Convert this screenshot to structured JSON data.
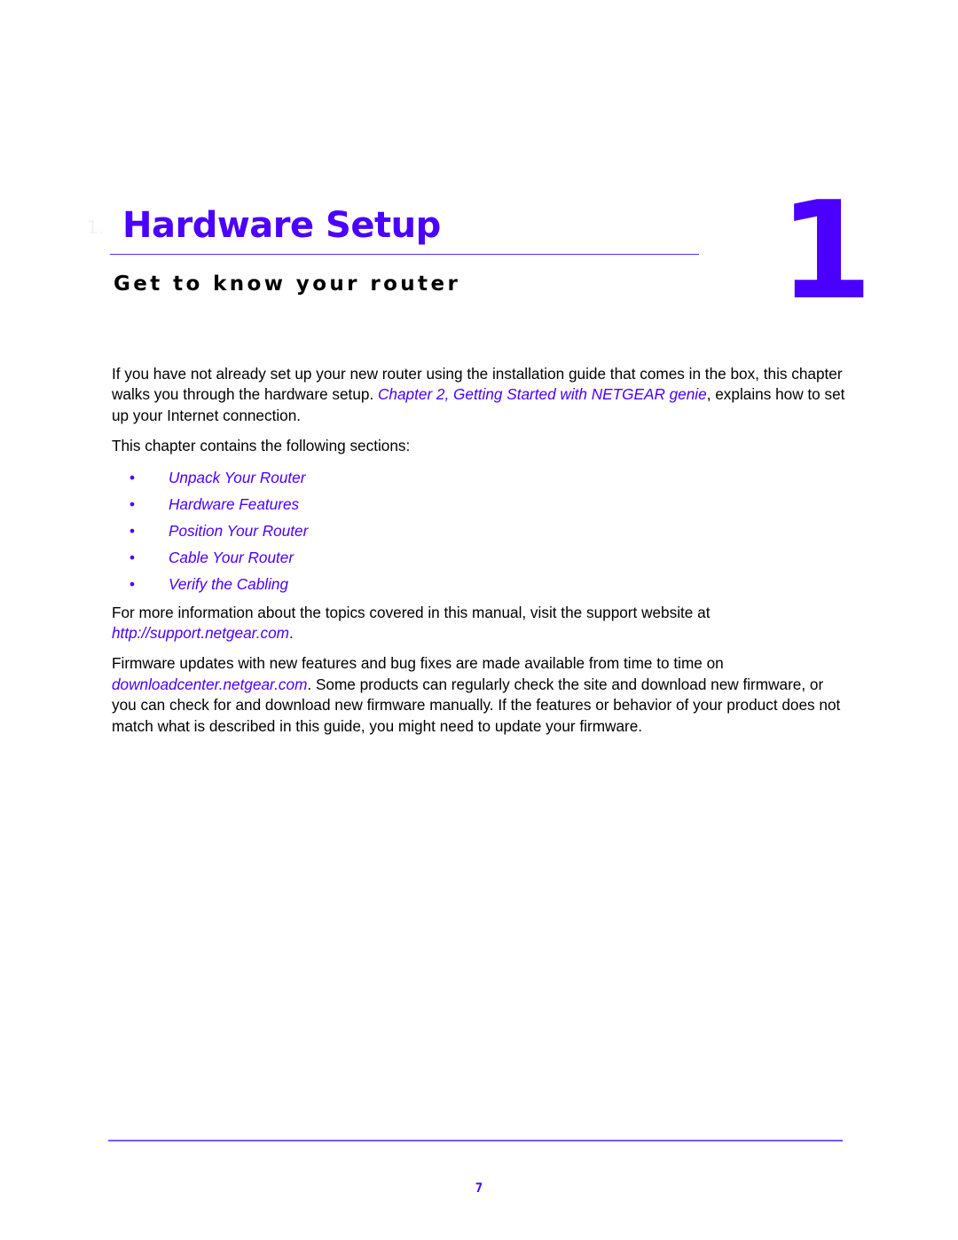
{
  "chapter": {
    "prefix": "1.",
    "title": "Hardware Setup",
    "number": "1",
    "subtitle": "Get to know your router"
  },
  "intro": {
    "text_before": "If you have not already set up your new router using the installation guide that comes in the box, this chapter walks you through the hardware setup. ",
    "link": "Chapter 2, Getting Started with NETGEAR genie",
    "text_after": ", explains how to set up your Internet connection."
  },
  "sections_intro": "This chapter contains the following sections:",
  "sections": [
    {
      "bullet": "•",
      "label": "Unpack Your Router"
    },
    {
      "bullet": "•",
      "label": "Hardware Features"
    },
    {
      "bullet": "•",
      "label": "Position Your Router"
    },
    {
      "bullet": "•",
      "label": "Cable Your Router"
    },
    {
      "bullet": "•",
      "label": "Verify the Cabling"
    }
  ],
  "support": {
    "text_before": "For more information about the topics covered in this manual, visit the support website at ",
    "link": "http://support.netgear.com",
    "text_after": "."
  },
  "firmware": {
    "text_before": "Firmware updates with new features and bug fixes are made available from time to time on ",
    "link": "downloadcenter.netgear.com",
    "text_after": ". Some products can regularly check the site and download new firmware, or you can check for and download new firmware manually. If the features or behavior of your product does not match what is described in this guide, you might need to update your firmware."
  },
  "footer": {
    "page_number": "7"
  },
  "colors": {
    "accent": "#4b00ff",
    "text": "#000000"
  }
}
